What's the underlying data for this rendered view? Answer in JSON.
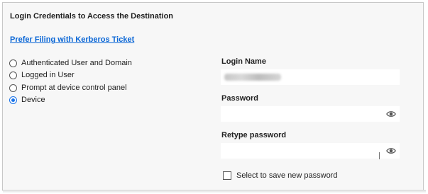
{
  "section": {
    "title": "Login Credentials to Access the Destination",
    "kerberos_link": "Prefer Filing with Kerberos Ticket"
  },
  "auth_options": [
    {
      "label": "Authenticated User and Domain",
      "selected": false
    },
    {
      "label": "Logged in User",
      "selected": false
    },
    {
      "label": "Prompt at device control panel",
      "selected": false
    },
    {
      "label": "Device",
      "selected": true
    }
  ],
  "login_name": {
    "label": "Login Name",
    "value": ""
  },
  "password": {
    "label": "Password",
    "value": ""
  },
  "retype_password": {
    "label": "Retype password",
    "value": ""
  },
  "save_password": {
    "label": "Select to save new password",
    "checked": false
  },
  "colors": {
    "accent": "#1a73e8",
    "link": "#0a66d6",
    "background": "#f7f7f7"
  }
}
